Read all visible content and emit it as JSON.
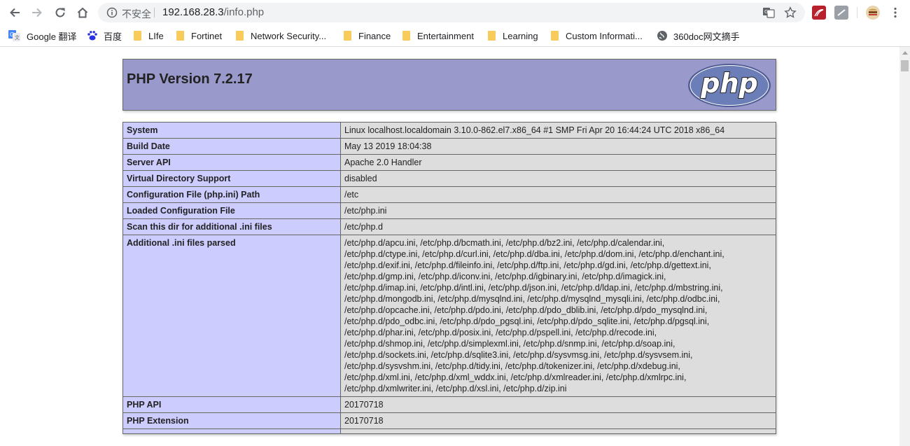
{
  "toolbar": {
    "security_label": "不安全",
    "url_host": "192.168.28.3",
    "url_path": "/info.php"
  },
  "bookmarks": [
    {
      "label": "Google 翻译",
      "icon": "google-translate-icon"
    },
    {
      "label": "百度",
      "icon": "baidu-icon"
    },
    {
      "label": "LIfe",
      "icon": "folder-icon"
    },
    {
      "label": "Fortinet",
      "icon": "folder-icon"
    },
    {
      "label": "Network Security...",
      "icon": "folder-icon"
    },
    {
      "label": "Finance",
      "icon": "folder-icon"
    },
    {
      "label": "Entertainment",
      "icon": "folder-icon"
    },
    {
      "label": "Learning",
      "icon": "folder-icon"
    },
    {
      "label": "Custom Informati...",
      "icon": "folder-icon"
    },
    {
      "label": "360doc网文摘手",
      "icon": "globe-icon"
    }
  ],
  "phpinfo": {
    "title": "PHP Version 7.2.17",
    "logo_text": "php",
    "rows": [
      {
        "key": "System",
        "value": "Linux localhost.localdomain 3.10.0-862.el7.x86_64 #1 SMP Fri Apr 20 16:44:24 UTC 2018 x86_64"
      },
      {
        "key": "Build Date",
        "value": "May 13 2019 18:04:38"
      },
      {
        "key": "Server API",
        "value": "Apache 2.0 Handler"
      },
      {
        "key": "Virtual Directory Support",
        "value": "disabled"
      },
      {
        "key": "Configuration File (php.ini) Path",
        "value": "/etc"
      },
      {
        "key": "Loaded Configuration File",
        "value": "/etc/php.ini"
      },
      {
        "key": "Scan this dir for additional .ini files",
        "value": "/etc/php.d"
      },
      {
        "key": "Additional .ini files parsed",
        "value": "/etc/php.d/apcu.ini, /etc/php.d/bcmath.ini, /etc/php.d/bz2.ini, /etc/php.d/calendar.ini,\n/etc/php.d/ctype.ini, /etc/php.d/curl.ini, /etc/php.d/dba.ini, /etc/php.d/dom.ini, /etc/php.d/enchant.ini,\n/etc/php.d/exif.ini, /etc/php.d/fileinfo.ini, /etc/php.d/ftp.ini, /etc/php.d/gd.ini, /etc/php.d/gettext.ini,\n/etc/php.d/gmp.ini, /etc/php.d/iconv.ini, /etc/php.d/igbinary.ini, /etc/php.d/imagick.ini,\n/etc/php.d/imap.ini, /etc/php.d/intl.ini, /etc/php.d/json.ini, /etc/php.d/ldap.ini, /etc/php.d/mbstring.ini,\n/etc/php.d/mongodb.ini, /etc/php.d/mysqlnd.ini, /etc/php.d/mysqlnd_mysqli.ini, /etc/php.d/odbc.ini,\n/etc/php.d/opcache.ini, /etc/php.d/pdo.ini, /etc/php.d/pdo_dblib.ini, /etc/php.d/pdo_mysqlnd.ini,\n/etc/php.d/pdo_odbc.ini, /etc/php.d/pdo_pgsql.ini, /etc/php.d/pdo_sqlite.ini, /etc/php.d/pgsql.ini,\n/etc/php.d/phar.ini, /etc/php.d/posix.ini, /etc/php.d/pspell.ini, /etc/php.d/recode.ini,\n/etc/php.d/shmop.ini, /etc/php.d/simplexml.ini, /etc/php.d/snmp.ini, /etc/php.d/soap.ini,\n/etc/php.d/sockets.ini, /etc/php.d/sqlite3.ini, /etc/php.d/sysvmsg.ini, /etc/php.d/sysvsem.ini,\n/etc/php.d/sysvshm.ini, /etc/php.d/tidy.ini, /etc/php.d/tokenizer.ini, /etc/php.d/xdebug.ini,\n/etc/php.d/xml.ini, /etc/php.d/xml_wddx.ini, /etc/php.d/xmlreader.ini, /etc/php.d/xmlrpc.ini,\n/etc/php.d/xmlwriter.ini, /etc/php.d/xsl.ini, /etc/php.d/zip.ini"
      },
      {
        "key": "PHP API",
        "value": "20170718"
      },
      {
        "key": "PHP Extension",
        "value": "20170718"
      },
      {
        "key": "",
        "value": ""
      }
    ]
  },
  "colors": {
    "header_bg": "#9999cc",
    "key_cell_bg": "#ccccff",
    "value_cell_bg": "#dddddd",
    "logo_bg": "#6c7eb7"
  }
}
